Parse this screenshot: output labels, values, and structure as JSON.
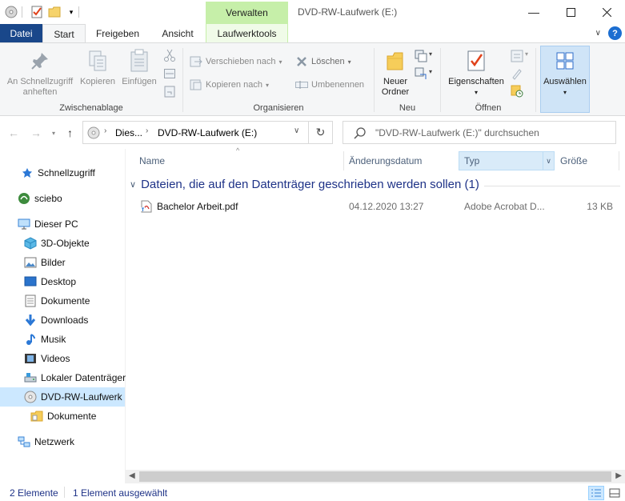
{
  "titlebar": {
    "context_tab_header": "Verwalten",
    "window_title": "DVD-RW-Laufwerk (E:)",
    "quick_access_icons": [
      "drive-icon",
      "properties-check-icon",
      "folder-icon",
      "dropdown-icon"
    ]
  },
  "ribbon_tabs": {
    "datei": "Datei",
    "start": "Start",
    "freigeben": "Freigeben",
    "ansicht": "Ansicht",
    "laufwerktools": "Laufwerktools",
    "help": "?"
  },
  "ribbon": {
    "clipboard": {
      "pin_label": "An Schnellzugriff anheften",
      "copy_label": "Kopieren",
      "paste_label": "Einfügen",
      "group_label": "Zwischenablage"
    },
    "organize": {
      "move_label": "Verschieben nach",
      "copyto_label": "Kopieren nach",
      "delete_label": "Löschen",
      "rename_label": "Umbenennen",
      "group_label": "Organisieren"
    },
    "new": {
      "new_folder_label": "Neuer Ordner",
      "group_label": "Neu"
    },
    "open": {
      "properties_label": "Eigenschaften",
      "group_label": "Öffnen"
    },
    "select": {
      "select_label": "Auswählen"
    }
  },
  "navigation": {
    "breadcrumb_1": "Dies...",
    "breadcrumb_2": "DVD-RW-Laufwerk (E:)",
    "search_placeholder": "\"DVD-RW-Laufwerk (E:)\" durchsuchen"
  },
  "sidebar": {
    "items": [
      {
        "label": "Schnellzugriff",
        "icon": "star-icon"
      },
      {
        "label": "sciebo",
        "icon": "sciebo-icon"
      },
      {
        "label": "Dieser PC",
        "icon": "computer-icon"
      },
      {
        "label": "3D-Objekte",
        "icon": "cube-icon"
      },
      {
        "label": "Bilder",
        "icon": "pictures-icon"
      },
      {
        "label": "Desktop",
        "icon": "desktop-icon"
      },
      {
        "label": "Dokumente",
        "icon": "documents-icon"
      },
      {
        "label": "Downloads",
        "icon": "download-icon"
      },
      {
        "label": "Musik",
        "icon": "music-icon"
      },
      {
        "label": "Videos",
        "icon": "video-icon"
      },
      {
        "label": "Lokaler Datenträger",
        "icon": "drive-icon"
      },
      {
        "label": "DVD-RW-Laufwerk",
        "icon": "dvd-icon"
      },
      {
        "label": "Dokumente",
        "icon": "folder-icon"
      },
      {
        "label": "Netzwerk",
        "icon": "network-icon"
      }
    ]
  },
  "content": {
    "columns": {
      "name": "Name",
      "date": "Änderungsdatum",
      "type": "Typ",
      "size": "Größe"
    },
    "group_header": "Dateien, die auf den Datenträger geschrieben werden sollen (1)",
    "files": [
      {
        "name": "Bachelor Arbeit.pdf",
        "date": "04.12.2020 13:27",
        "type": "Adobe Acrobat D...",
        "size": "13 KB"
      }
    ]
  },
  "statusbar": {
    "count": "2 Elemente",
    "selected": "1 Element ausgewählt"
  },
  "colors": {
    "accent": "#19478a",
    "context_tab": "#c6efa9",
    "selection": "#cce8ff",
    "link_text": "#1e3287"
  }
}
